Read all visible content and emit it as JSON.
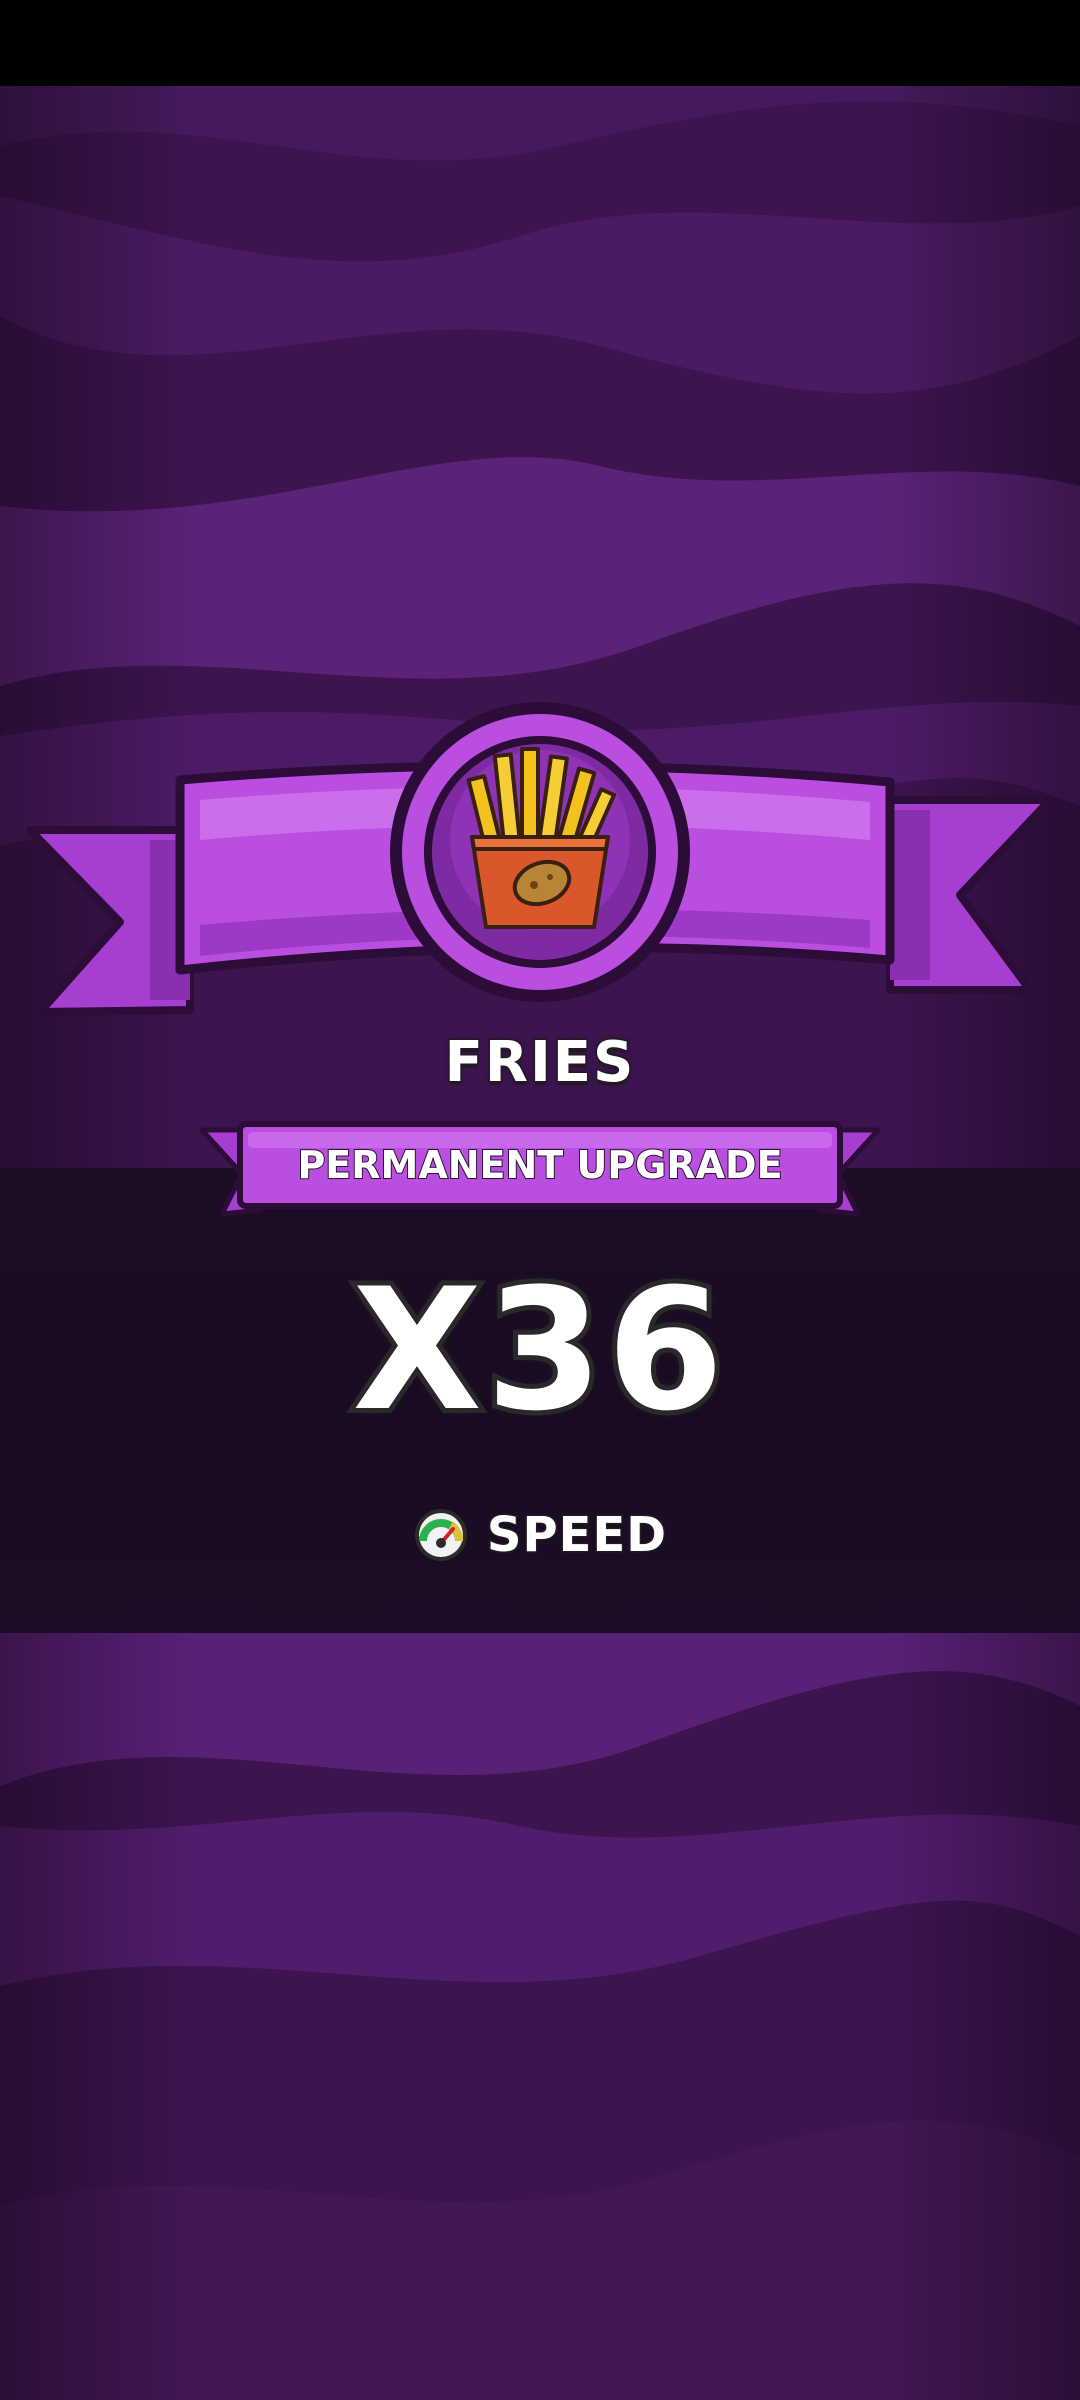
{
  "item": {
    "name": "FRIES",
    "icon": "fries-icon",
    "banner_text": "PERMANENT UPGRADE",
    "multiplier": "X36"
  },
  "stat": {
    "icon": "speedometer-icon",
    "label": "SPEED"
  },
  "colors": {
    "background": "#3e1552",
    "ribbon": "#b94ee0",
    "ribbon_dark": "#8a2fb0",
    "dark_band": "#1c0c24",
    "fries_box": "#d9572a",
    "fries": "#f4c21f"
  }
}
